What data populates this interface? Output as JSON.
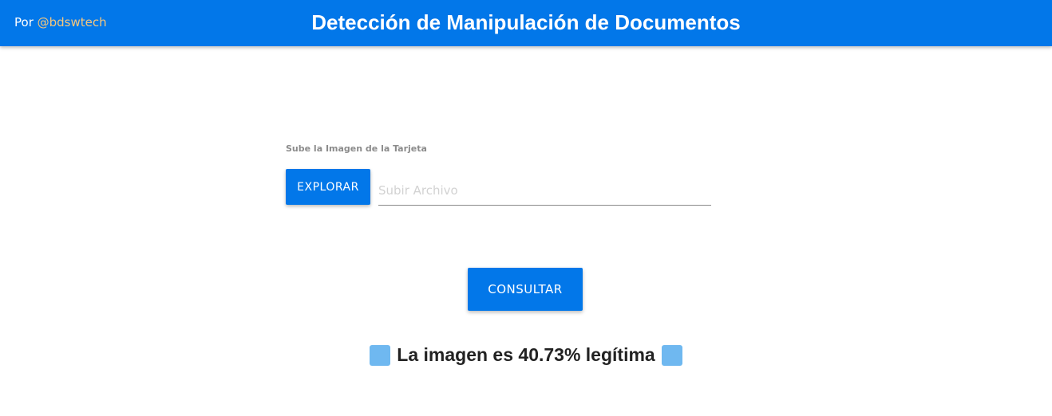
{
  "header": {
    "author_prefix": "Por",
    "author_handle": "@bdswtech",
    "title": "Detección de Manipulación de Documentos"
  },
  "upload": {
    "label": "Sube la Imagen de la Tarjeta",
    "browse_label": "EXPLORAR",
    "file_placeholder": "Subir Archivo",
    "file_value": ""
  },
  "actions": {
    "query_label": "CONSULTAR"
  },
  "result": {
    "text": "La imagen es 40.73% legítima",
    "icon_left": "blue-square-icon",
    "icon_right": "blue-square-icon"
  },
  "colors": {
    "primary": "#0277e9",
    "handle": "#f5c77e",
    "square": "#6fb8f0"
  }
}
